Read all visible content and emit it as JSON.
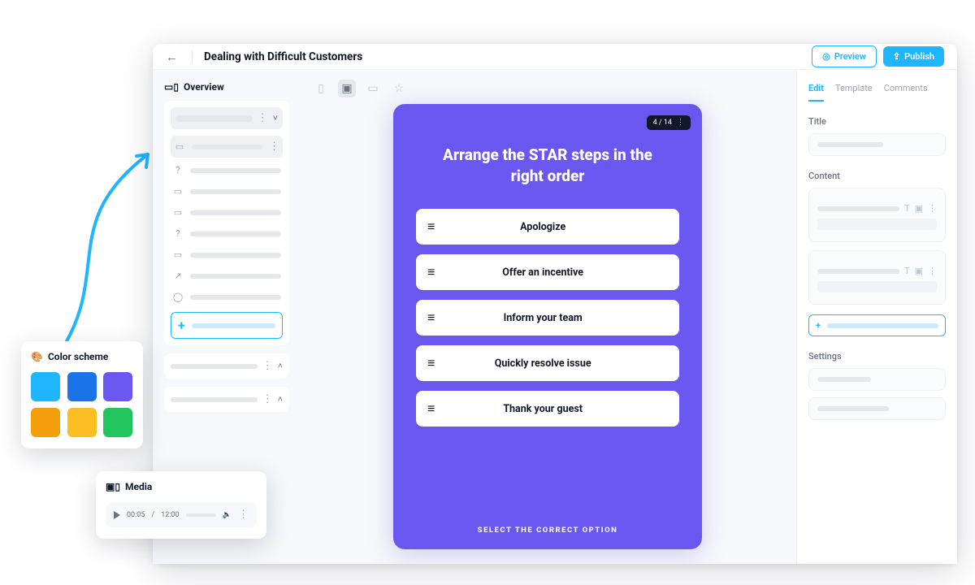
{
  "header": {
    "title": "Dealing with Difficult Customers",
    "preview_label": "Preview",
    "publish_label": "Publish"
  },
  "sidebar": {
    "overview_label": "Overview"
  },
  "canvas": {
    "pager": "4 / 14",
    "question_title": "Arrange the STAR steps in the right order",
    "options": [
      "Apologize",
      "Offer an incentive",
      "Inform your team",
      "Quickly resolve issue",
      "Thank your guest"
    ],
    "instruction": "SELECT THE CORRECT OPTION"
  },
  "inspector": {
    "tabs": [
      "Edit",
      "Template",
      "Comments"
    ],
    "title_label": "Title",
    "content_label": "Content",
    "settings_label": "Settings"
  },
  "color_panel": {
    "title": "Color scheme",
    "swatches": [
      "#1fb6ff",
      "#1a73e8",
      "#6a57f0",
      "#f59e0b",
      "#fbbf24",
      "#22c55e"
    ]
  },
  "media_panel": {
    "title": "Media",
    "time_current": "00:05",
    "time_total": "12:00"
  }
}
